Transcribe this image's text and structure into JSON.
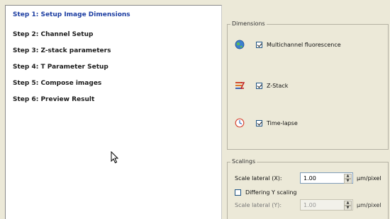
{
  "steps": [
    {
      "label": "Step 1: Setup Image Dimensions",
      "active": true
    },
    {
      "label": "Step 2: Channel Setup",
      "active": false
    },
    {
      "label": "Step 3: Z-stack parameters",
      "active": false
    },
    {
      "label": "Step 4: T Parameter Setup",
      "active": false
    },
    {
      "label": "Step 5: Compose images",
      "active": false
    },
    {
      "label": "Step 6: Preview Result",
      "active": false
    }
  ],
  "dimensions": {
    "title": "Dimensions",
    "options": [
      {
        "label": "Multichannel fluorescence",
        "checked": true,
        "icon": "globe-icon"
      },
      {
        "label": "Z-Stack",
        "checked": true,
        "icon": "z-stack-icon"
      },
      {
        "label": "Time-lapse",
        "checked": true,
        "icon": "clock-icon"
      }
    ]
  },
  "scalings": {
    "title": "Scalings",
    "lateral_x": {
      "label": "Scale lateral (X):",
      "value": "1.00",
      "unit": "µm/pixel"
    },
    "differing_y": {
      "label": "Differing Y scaling",
      "checked": false
    },
    "lateral_y": {
      "label": "Scale lateral (Y):",
      "value": "1.00",
      "unit": "µm/pixel",
      "disabled": true
    }
  },
  "colors": {
    "active_step": "#1d3ea2",
    "background": "#ece9d8"
  }
}
